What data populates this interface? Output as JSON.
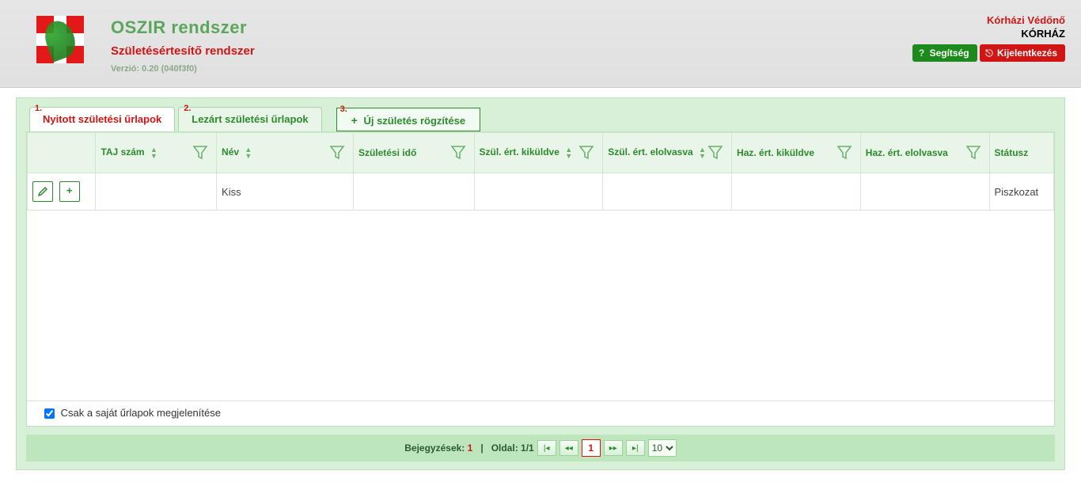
{
  "header": {
    "app_title": "OSZIR rendszer",
    "app_subtitle": "Születésértesítő rendszer",
    "version_label": "Verzió:  0.20 (040f3f0)"
  },
  "user": {
    "role": "Kórházi Védőnő",
    "place": "KÓRHÁZ"
  },
  "buttons": {
    "help": "Segítség",
    "logout": "Kijelentkezés"
  },
  "tabs": {
    "open_num": "1.",
    "open_label": "Nyitott születési űrlapok",
    "closed_num": "2.",
    "closed_label": "Lezárt születési űrlapok",
    "new_num": "3.",
    "new_label": "Új születés rögzítése"
  },
  "columns": {
    "taj": "TAJ szám",
    "nev": "Név",
    "szido": "Születési idő",
    "szk": "Szül. ért. kiküldve",
    "szo": "Szül. ért. elolvasva",
    "hk": "Haz. ért. kiküldve",
    "ho": "Haz. ért. elolvasva",
    "status": "Státusz"
  },
  "row": {
    "taj": "",
    "nev": "Kiss",
    "szido": "",
    "szk": "",
    "szo": "",
    "hk": "",
    "ho": "",
    "status": "Piszkozat"
  },
  "footer": {
    "own_forms": "Csak a saját űrlapok megjelenítése"
  },
  "pager": {
    "entries_label": "Bejegyzések:",
    "entries_val": "1",
    "page_label": "Oldal:",
    "page_val": "1/1",
    "current": "1",
    "perpage": "10"
  }
}
